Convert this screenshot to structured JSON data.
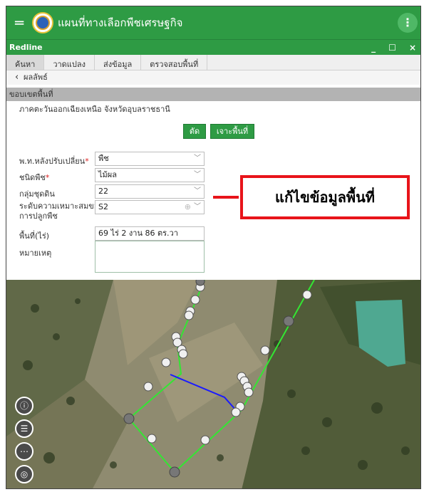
{
  "app": {
    "title": "แผนที่ทางเลือกพืชเศรษฐกิจ",
    "menu_icon": "hamburger-icon",
    "overflow_icon": "more-vertical-icon"
  },
  "window": {
    "title": "Redline",
    "minimize": "_",
    "maximize": "☐",
    "close": "×"
  },
  "tabs": [
    {
      "label": "ค้นหา"
    },
    {
      "label": "วาดแปลง"
    },
    {
      "label": "ส่งข้อมูล"
    },
    {
      "label": "ตรวจสอบพื้นที่"
    }
  ],
  "back": {
    "label": "ผลลัพธ์",
    "icon": "chevron-left-icon"
  },
  "section": {
    "title": "ขอบเขตพื้นที่"
  },
  "region": {
    "text": "ภาคตะวันออกเฉียงเหนือ จังหวัดอุบลราชธานี"
  },
  "buttons": {
    "cut": "ตัด",
    "drill": "เจาะพื้นที่"
  },
  "form": {
    "land_use": {
      "label": "พ.ท.หลังปรับเปลี่ยน",
      "value": "พืช"
    },
    "crop_type": {
      "label": "ชนิดพืช",
      "value": "ไม้ผล"
    },
    "soil_group": {
      "label": "กลุ่มชุดดิน",
      "value": "22"
    },
    "suitability": {
      "label_line1": "ระดับความเหมาะสมของ",
      "label_line2": "การปลูกพืช",
      "value": "S2"
    },
    "area": {
      "label": "พื้นที่(ไร่)",
      "value": "69 ไร่ 2 งาน 86 ตร.วา"
    },
    "remark": {
      "label": "หมายเหตุ",
      "value": ""
    },
    "required_mark": "*"
  },
  "callout": {
    "text": "แก้ไขข้อมูลพื้นที่"
  },
  "map_tools": [
    {
      "icon": "info-icon",
      "glyph": "ⓘ"
    },
    {
      "icon": "list-icon",
      "glyph": "☰"
    },
    {
      "icon": "more-horizontal-icon",
      "glyph": "⋯"
    },
    {
      "icon": "locate-icon",
      "glyph": "◎"
    }
  ],
  "colors": {
    "brand_green": "#2e9b44",
    "callout_red": "#e8141a",
    "polygon_green": "#33e633",
    "polygon_blue": "#1a1aff"
  }
}
